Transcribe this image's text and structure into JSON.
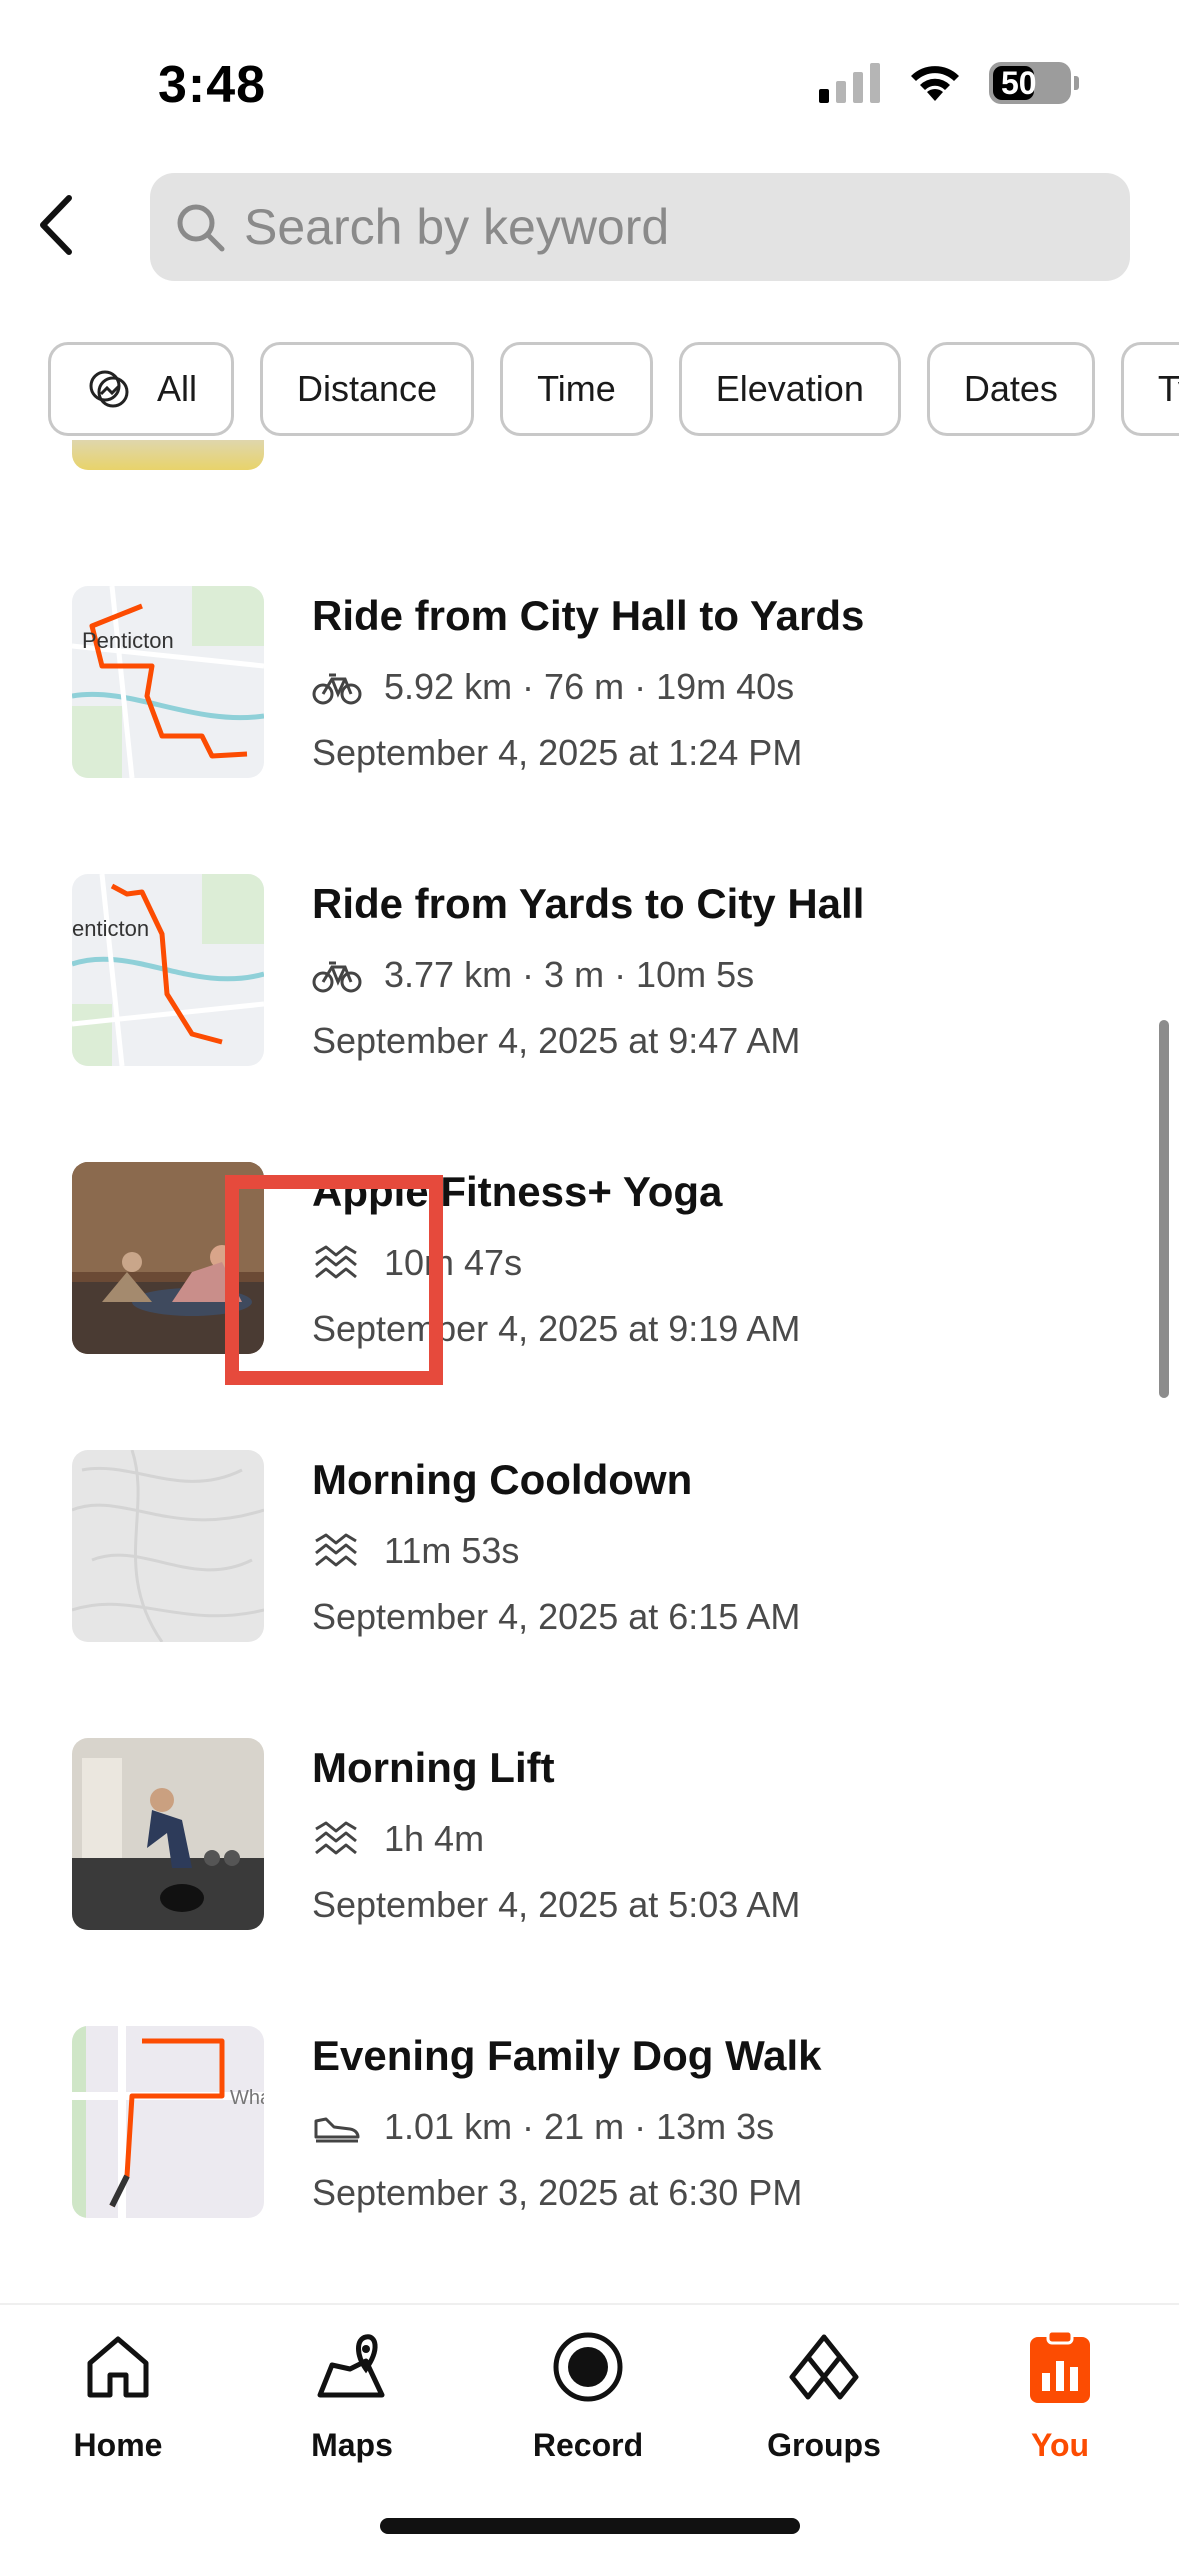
{
  "status_bar": {
    "time": "3:48",
    "battery": "50"
  },
  "search": {
    "placeholder": "Search by keyword"
  },
  "filters": [
    {
      "label": "All",
      "icon": "all-activities-icon"
    },
    {
      "label": "Distance"
    },
    {
      "label": "Time"
    },
    {
      "label": "Elevation"
    },
    {
      "label": "Dates"
    },
    {
      "label": "Typ"
    }
  ],
  "activities": [
    {
      "title": "Ride from City Hall to Yards",
      "sport_icon": "bike-icon",
      "stats": "5.92 km · 76 m · 19m 40s",
      "date": "September 4, 2025 at 1:24 PM",
      "thumb": "map",
      "map_label": "Penticton"
    },
    {
      "title": "Ride from Yards to City Hall",
      "sport_icon": "bike-icon",
      "stats": "3.77 km · 3 m · 10m 5s",
      "date": "September 4, 2025 at 9:47 AM",
      "thumb": "map",
      "map_label": "enticton"
    },
    {
      "title": "Apple Fitness+ Yoga",
      "sport_icon": "workout-icon",
      "stats": "10m 47s",
      "date": "September 4, 2025 at 9:19 AM",
      "thumb": "photo"
    },
    {
      "title": "Morning Cooldown",
      "sport_icon": "workout-icon",
      "stats": "11m 53s",
      "date": "September 4, 2025 at 6:15 AM",
      "thumb": "topo"
    },
    {
      "title": "Morning Lift",
      "sport_icon": "workout-icon",
      "stats": "1h 4m",
      "date": "September 4, 2025 at 5:03 AM",
      "thumb": "photo"
    },
    {
      "title": "Evening Family Dog Walk",
      "sport_icon": "walk-shoe-icon",
      "stats": "1.01 km · 21 m · 13m 3s",
      "date": "September 3, 2025 at 6:30 PM",
      "thumb": "map",
      "map_label": "Wha"
    }
  ],
  "tabs": [
    {
      "label": "Home",
      "icon": "home-icon"
    },
    {
      "label": "Maps",
      "icon": "maps-icon"
    },
    {
      "label": "Record",
      "icon": "record-icon"
    },
    {
      "label": "Groups",
      "icon": "groups-icon"
    },
    {
      "label": "You",
      "icon": "you-icon",
      "active": true
    }
  ],
  "colors": {
    "accent": "#fc4c02",
    "highlight": "#e64a3c"
  }
}
